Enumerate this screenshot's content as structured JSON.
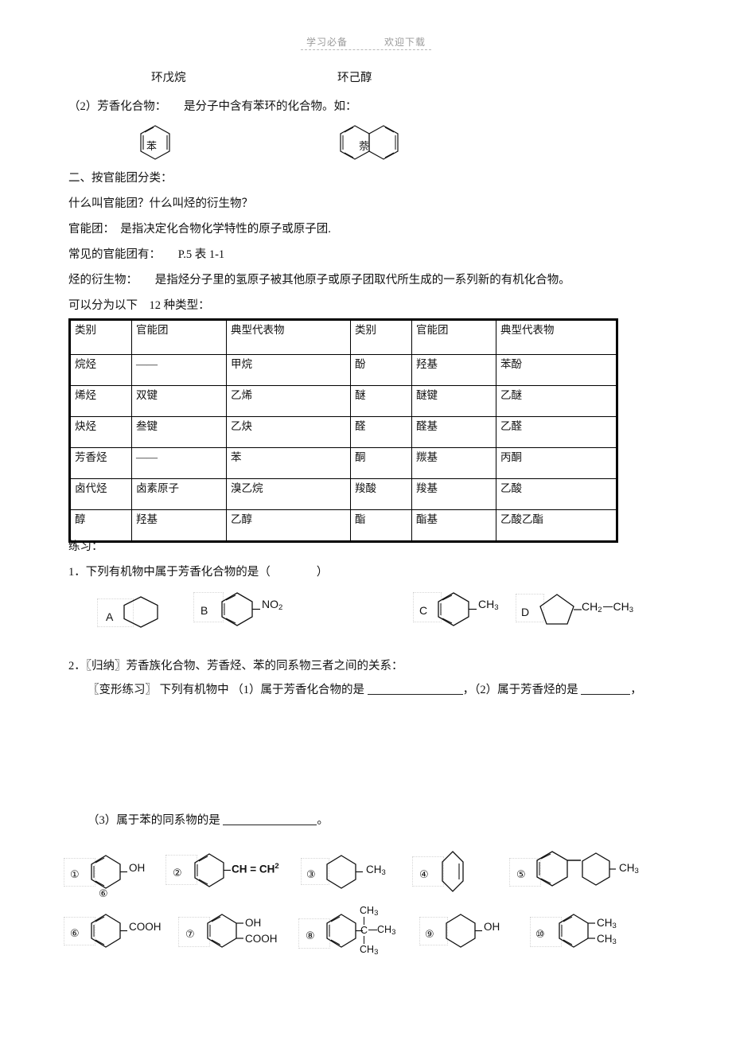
{
  "header": {
    "left_text": "学习必备",
    "right_text": "欢迎下载"
  },
  "captions": {
    "cyclopentane": "环戊烷",
    "cyclohexanol": "环己醇",
    "benzene": "苯",
    "naphthalene": "萘"
  },
  "body_lines": {
    "l_aromatic_def": "（2）芳香化合物：　　是分子中含有苯环的化合物。如：",
    "l_section2": "二、按官能团分类：",
    "l_q_what": "什么叫官能团？什么叫烃的衍生物？",
    "l_functional_def": "官能团：　是指决定化合物化学特性的原子或原子团.",
    "l_common": "常见的官能团有：　　P.5 表 1-1",
    "l_derivative_def": "烃的衍生物：　　是指烃分子里的氢原子被其他原子或原子团取代所生成的一系列新的有机化合物。",
    "l_types": "可以分为以下　12 种类型：",
    "l_practice": "练习：",
    "l_q1": "1．下列有机物中属于芳香化合物的是（　　　　）",
    "l_q2": "2．〖归纳〗芳香族化合物、芳香烃、苯的同系物三者之间的关系：",
    "l_q2b_pre": "〖变形练习〗 下列有机物中 （1）属于芳香化合物的是",
    "l_q2b_mid": "，（2）属于芳香烃的是",
    "l_q2b_end": "，",
    "l_q3_pre": "（3）属于苯的同系物的是",
    "l_q3_end": "。"
  },
  "table": {
    "headers": [
      "类别",
      "官能团",
      "典型代表物",
      "类别",
      "官能团",
      "典型代表物"
    ],
    "rows": [
      [
        "烷烃",
        "——",
        "甲烷",
        "酚",
        "羟基",
        "苯酚"
      ],
      [
        "烯烃",
        "双键",
        "乙烯",
        "醚",
        "醚键",
        "乙醚"
      ],
      [
        "炔烃",
        "叁键",
        "乙炔",
        "醛",
        "醛基",
        "乙醛"
      ],
      [
        "芳香烃",
        "——",
        "苯",
        "酮",
        "羰基",
        "丙酮"
      ],
      [
        "卤代烃",
        "卤素原子",
        "溴乙烷",
        "羧酸",
        "羧基",
        "乙酸"
      ],
      [
        "醇",
        "羟基",
        "乙醇",
        "酯",
        "酯基",
        "乙酸乙酯"
      ]
    ]
  },
  "q1_options": [
    {
      "key": "A",
      "ring": "cyclohexane",
      "substituent": ""
    },
    {
      "key": "B",
      "ring": "benzene",
      "substituent": "NO2"
    },
    {
      "key": "C",
      "ring": "benzene",
      "substituent": "CH3"
    },
    {
      "key": "D",
      "ring": "cyclopentane",
      "substituent": "CH2CH3"
    }
  ],
  "q1_labels": {
    "a": "A",
    "b": "B",
    "c": "C",
    "d": "D",
    "no2_c": "NO",
    "no2_n": "2",
    "ch3_c": "CH",
    "ch3_n": "3",
    "ch2_c": "CH",
    "ch2_n": "2"
  },
  "structures_row1": [
    {
      "num": "①",
      "ring": "benzene",
      "substituent": "OH",
      "extra_num": "⑥"
    },
    {
      "num": "②",
      "ring": "benzene",
      "substituent": "CH=CH2"
    },
    {
      "num": "③",
      "ring": "cyclohexane",
      "substituent": "CH3"
    },
    {
      "num": "④",
      "ring": "cyclohexene",
      "substituent": ""
    },
    {
      "num": "⑤",
      "ring": "biphenyl-cyclohexane",
      "substituent": "CH3"
    }
  ],
  "structures_row2": [
    {
      "num": "⑥",
      "ring": "benzene",
      "substituent": "COOH"
    },
    {
      "num": "⑦",
      "ring": "benzene",
      "substituent": "OH+COOH"
    },
    {
      "num": "⑧",
      "ring": "benzene",
      "substituent": "C(CH3)3"
    },
    {
      "num": "⑨",
      "ring": "cyclohexane",
      "substituent": "OH"
    },
    {
      "num": "⑩",
      "ring": "benzene",
      "substituent": "CH3+CH3"
    }
  ],
  "formula_text": {
    "OH": "OH",
    "COOH": "COOH",
    "CH": "CH",
    "C": "C",
    "eq": "=",
    "sub2": "2",
    "sub3": "3"
  }
}
